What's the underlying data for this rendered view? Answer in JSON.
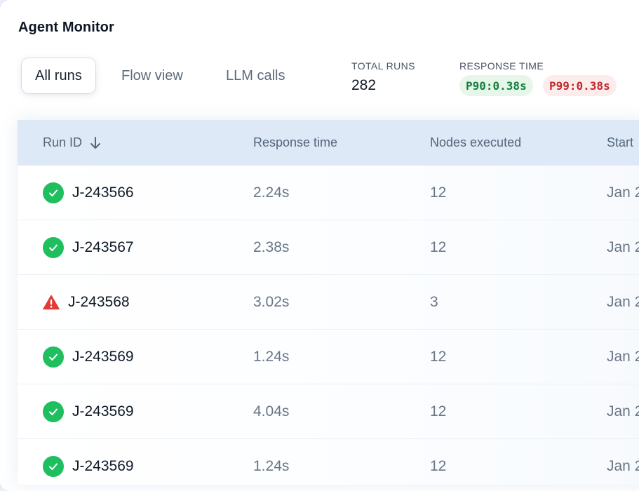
{
  "app": {
    "title": "Agent Monitor"
  },
  "tabs": [
    {
      "label": "All runs",
      "active": true
    },
    {
      "label": "Flow view",
      "active": false
    },
    {
      "label": "LLM calls",
      "active": false
    }
  ],
  "stats": {
    "total_runs_label": "TOTAL RUNS",
    "total_runs_value": "282",
    "response_time_label": "RESPONSE TIME",
    "p90": "P90:0.38s",
    "p99": "P99:0.38s"
  },
  "colors": {
    "success": "#1fbf5f",
    "warning": "#e53935",
    "header_bg": "#dde9f7"
  },
  "table": {
    "columns": [
      "Run ID",
      "Response time",
      "Nodes executed",
      "Start"
    ],
    "sort_icon": "arrow-down-icon",
    "rows": [
      {
        "status": "success",
        "status_icon": "check-circle-icon",
        "run_id": "J-243566",
        "response_time": "2.24s",
        "nodes": "12",
        "start": "Jan 2"
      },
      {
        "status": "success",
        "status_icon": "check-circle-icon",
        "run_id": "J-243567",
        "response_time": "2.38s",
        "nodes": "12",
        "start": "Jan 2"
      },
      {
        "status": "warning",
        "status_icon": "warning-triangle-icon",
        "run_id": "J-243568",
        "response_time": "3.02s",
        "nodes": "3",
        "start": "Jan 2"
      },
      {
        "status": "success",
        "status_icon": "check-circle-icon",
        "run_id": "J-243569",
        "response_time": "1.24s",
        "nodes": "12",
        "start": "Jan 2"
      },
      {
        "status": "success",
        "status_icon": "check-circle-icon",
        "run_id": "J-243569",
        "response_time": "4.04s",
        "nodes": "12",
        "start": "Jan 2"
      },
      {
        "status": "success",
        "status_icon": "check-circle-icon",
        "run_id": "J-243569",
        "response_time": "1.24s",
        "nodes": "12",
        "start": "Jan 2"
      }
    ]
  }
}
